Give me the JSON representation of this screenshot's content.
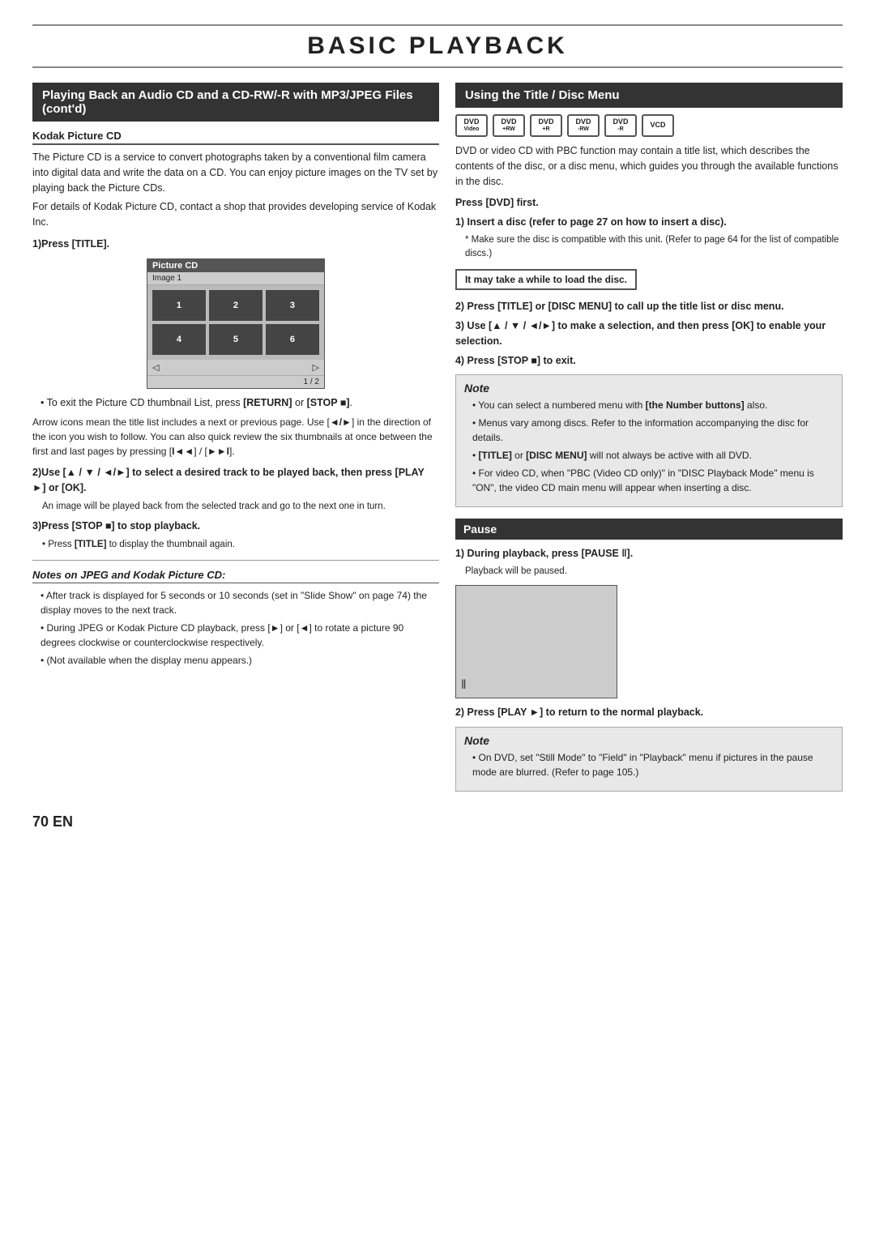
{
  "page": {
    "title": "BASIC PLAYBACK",
    "page_number": "70 EN"
  },
  "left_section": {
    "header": "Playing Back an Audio CD and a CD-RW/-R with MP3/JPEG Files (cont'd)",
    "kodak_header": "Kodak Picture CD",
    "kodak_intro": "The Picture CD is a service to convert photographs taken by a conventional film camera into digital data and write the data on a CD. You can enjoy picture images on the TV set by playing back the Picture CDs.",
    "kodak_contact": "For details of Kodak Picture CD, contact a shop that provides developing service of Kodak Inc.",
    "step1_label": "1)Press [TITLE].",
    "picture_cd": {
      "title": "Picture CD",
      "subtitle": "Image 1",
      "thumbnails": [
        "1",
        "2",
        "3",
        "4",
        "5",
        "6"
      ],
      "page": "1 / 2"
    },
    "bullet1": "To exit the Picture CD thumbnail List, press [RETURN] or [STOP ■].",
    "arrow_note": "Arrow icons mean the title list includes a next or previous page. Use [◄/►] in the direction of the icon you wish to follow. You can also quick review the six thumbnails at once between the first and last pages by pressing [I◄◄] / [►►I].",
    "step2_label": "2)Use [▲ / ▼ / ◄/►] to select a desired track to be played back, then press [PLAY ►] or [OK].",
    "step2_detail": "An image will be played back from the selected track and go to the next one in turn.",
    "step3_label": "3)Press [STOP ■] to stop playback.",
    "step3_detail": "• Press [TITLE] to display the thumbnail again.",
    "notes_header": "Notes on JPEG and Kodak Picture CD:",
    "notes": [
      "After track is displayed for 5 seconds or 10 seconds (set in \"Slide Show\" on page 74) the display moves to the next track.",
      "During JPEG or Kodak Picture CD playback, press [►] or [◄] to rotate a picture 90 degrees clockwise or counterclockwise respectively.",
      "(Not available when the display menu appears.)"
    ]
  },
  "right_section": {
    "header": "Using the Title / Disc Menu",
    "disc_icons": [
      {
        "top": "DVD",
        "sub": "Video"
      },
      {
        "top": "DVD",
        "sub": "+RW"
      },
      {
        "top": "DVD",
        "sub": "+R"
      },
      {
        "top": "DVD",
        "sub": "-RW"
      },
      {
        "top": "DVD",
        "sub": "-R"
      },
      {
        "top": "VCD",
        "sub": ""
      }
    ],
    "intro": "DVD or video CD with PBC function may contain a title list, which describes the contents of the disc, or a disc menu, which guides you through the available functions in the disc.",
    "press_dvd_first": "Press [DVD] first.",
    "step1_label": "1) Insert a disc (refer to page 27 on how to insert a disc).",
    "step1_note": "* Make sure the disc is compatible with this unit. (Refer to page 64 for the list of compatible discs.)",
    "important_text": "It may take a while to load the disc.",
    "step2_label": "2) Press [TITLE] or [DISC MENU] to call up the title list or disc menu.",
    "step3_label": "3) Use [▲ / ▼ / ◄/►] to make a selection, and then press [OK] to enable your selection.",
    "step4_label": "4) Press [STOP ■] to exit.",
    "note_header": "Note",
    "notes": [
      "You can select a numbered menu with [the Number buttons] also.",
      "Menus vary among discs. Refer to the information accompanying the disc for details.",
      "[TITLE] or [DISC MENU] will not always be active with all DVD.",
      "For video CD, when \"PBC (Video CD only)\" in \"DISC Playback Mode\" menu is \"ON\", the video CD main menu will appear when inserting a disc."
    ],
    "pause_header": "Pause",
    "pause_step1": "1) During playback, press [PAUSE ‖].",
    "pause_step1_detail": "Playback will be paused.",
    "pause_step2": "2) Press [PLAY ►] to return to the normal playback.",
    "pause_note_header": "Note",
    "pause_notes": [
      "On DVD, set \"Still Mode\" to \"Field\" in \"Playback\" menu if pictures in the pause mode are blurred. (Refer to page 105.)"
    ]
  }
}
